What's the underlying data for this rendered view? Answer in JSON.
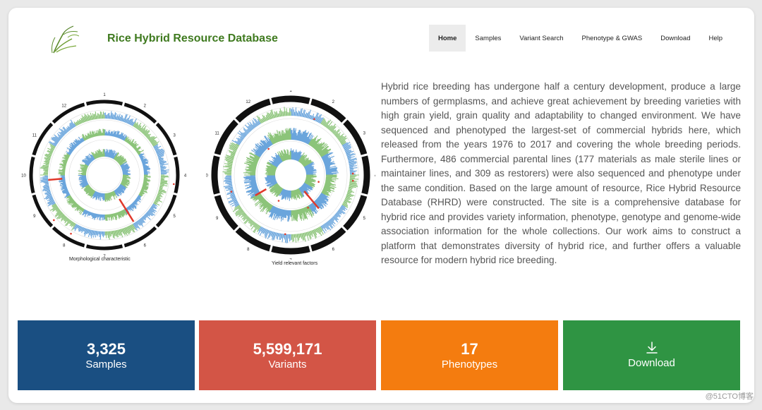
{
  "header": {
    "title": "Rice Hybrid Resource Database",
    "logo_icon": "rice-plant-icon"
  },
  "nav": {
    "items": [
      {
        "label": "Home",
        "active": true
      },
      {
        "label": "Samples"
      },
      {
        "label": "Variant Search"
      },
      {
        "label": "Phenotype & GWAS"
      },
      {
        "label": "Download"
      },
      {
        "label": "Help"
      }
    ]
  },
  "figures": [
    {
      "caption": "Morphological characteristic",
      "chromosomes": [
        "1",
        "2",
        "3",
        "4",
        "5",
        "6",
        "7",
        "8",
        "9",
        "10",
        "11",
        "12"
      ]
    },
    {
      "caption": "Yield relevant factors",
      "chromosomes": [
        "1",
        "2",
        "3",
        "4",
        "5",
        "6",
        "7",
        "8",
        "9",
        "10",
        "11",
        "12"
      ]
    }
  ],
  "intro": {
    "text": "Hybrid rice breeding has undergone half a century development, produce a large numbers of germplasms, and achieve great achievement by breeding varieties with high grain yield, grain quality and adaptability to changed environment. We have sequenced and phenotyped the largest-set of commercial hybrids here, which released from the years 1976 to 2017 and covering the whole breeding periods. Furthermore, 486 commercial parental lines (177 materials as male sterile lines or maintainer lines, and 309 as restorers) were also sequenced and phenotype under the same condition. Based on the large amount of resource, Rice Hybrid Resource Database (RHRD) were constructed. The site is a comprehensive database for hybrid rice and provides variety information, phenotype, genotype and genome-wide association information for the whole collections. Our work aims to construct a platform that demonstrates diversity of hybrid rice, and further offers a valuable resource for modern hybrid rice breeding."
  },
  "stats": {
    "samples": {
      "value": "3,325",
      "label": "Samples",
      "color": "#1a4f82"
    },
    "variants": {
      "value": "5,599,171",
      "label": "Variants",
      "color": "#d35546"
    },
    "phenotypes": {
      "value": "17",
      "label": "Phenotypes",
      "color": "#f47c0f"
    },
    "download": {
      "label": "Download",
      "icon": "download-icon",
      "color": "#2f9443"
    }
  },
  "colors": {
    "blue": "#6aa5dc",
    "green": "#8cc47a",
    "title_green": "#3f7a1f"
  },
  "watermark": "@51CTO博客"
}
